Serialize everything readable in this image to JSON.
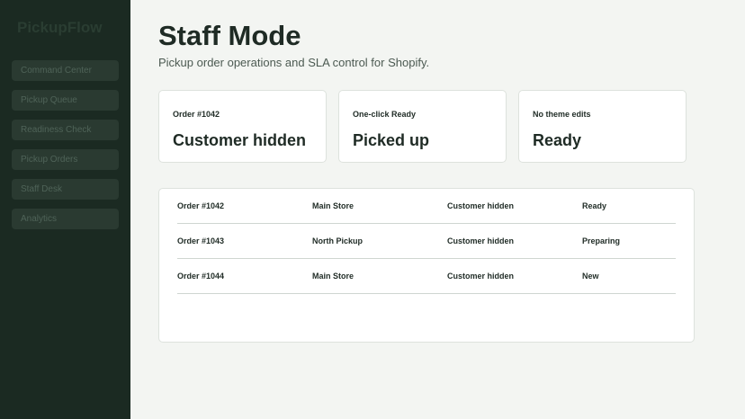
{
  "app": {
    "brand": "PickupFlow"
  },
  "sidebar": {
    "items": [
      {
        "label": "Command Center"
      },
      {
        "label": "Pickup Queue"
      },
      {
        "label": "Readiness Check"
      },
      {
        "label": "Pickup Orders"
      },
      {
        "label": "Staff Desk"
      },
      {
        "label": "Analytics"
      }
    ]
  },
  "header": {
    "title": "Staff Mode",
    "subtitle": "Pickup order operations and SLA control for Shopify."
  },
  "cards": [
    {
      "label": "Order #1042",
      "value": "Customer hidden"
    },
    {
      "label": "One-click Ready",
      "value": "Picked up"
    },
    {
      "label": "No theme edits",
      "value": "Ready"
    }
  ],
  "orders": {
    "rows": [
      {
        "order": "Order #1042",
        "location": "Main Store",
        "customer": "Customer hidden",
        "status": "Ready"
      },
      {
        "order": "Order #1043",
        "location": "North Pickup",
        "customer": "Customer hidden",
        "status": "Preparing"
      },
      {
        "order": "Order #1044",
        "location": "Main Store",
        "customer": "Customer hidden",
        "status": "New"
      }
    ]
  },
  "colors": {
    "sidebar_bg": "#1b2a22",
    "page_bg": "#f3f5f2",
    "text": "#1f2b25"
  }
}
